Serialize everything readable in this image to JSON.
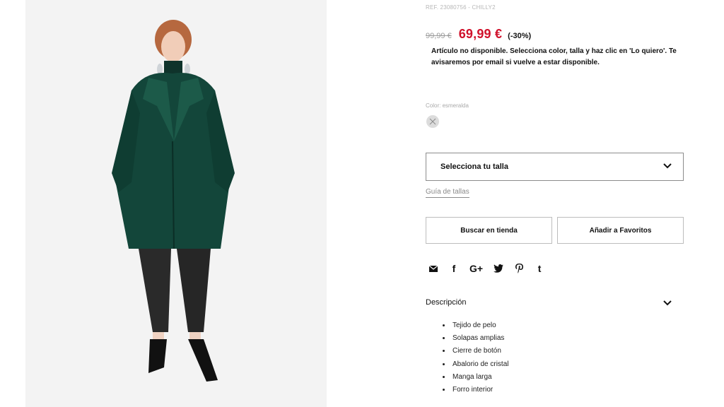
{
  "product": {
    "ref": "REF. 23080756 - CHILLY2",
    "old_price": "99,99 €",
    "new_price": "69,99 €",
    "discount": "(-30%)",
    "notice": "Artículo no disponible. Selecciona color, talla y haz clic en 'Lo quiero'. Te avisaremos por email si vuelve a estar disponible."
  },
  "color": {
    "label": "Color: esmeralda",
    "swatch_icon": "unavailable-x-icon"
  },
  "size": {
    "select_label": "Selecciona tu talla",
    "guide_link": "Guía de tallas"
  },
  "actions": {
    "store_button": "Buscar en tienda",
    "favorites_button": "Añadir a Favoritos"
  },
  "social": {
    "icons": [
      "email-icon",
      "facebook-icon",
      "google-plus-icon",
      "twitter-icon",
      "pinterest-icon",
      "tumblr-icon"
    ]
  },
  "description": {
    "title": "Descripción",
    "items": [
      "Tejido de pelo",
      "Solapas amplias",
      "Cierre de botón",
      "Abalorio de cristal",
      "Manga larga",
      "Forro interior"
    ]
  },
  "colors": {
    "price_red": "#d0112b",
    "coat_green": "#13463a",
    "background": "#f3f3f3"
  }
}
